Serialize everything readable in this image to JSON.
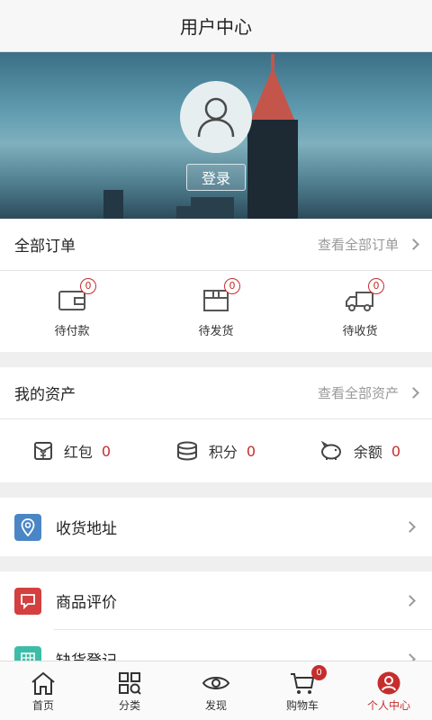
{
  "header": {
    "title": "用户中心"
  },
  "hero": {
    "login_label": "登录"
  },
  "orders": {
    "title": "全部订单",
    "more": "查看全部订单",
    "items": [
      {
        "label": "待付款",
        "count": "0",
        "icon": "wallet-icon"
      },
      {
        "label": "待发货",
        "count": "0",
        "icon": "package-icon"
      },
      {
        "label": "待收货",
        "count": "0",
        "icon": "truck-icon"
      }
    ]
  },
  "assets": {
    "title": "我的资产",
    "more": "查看全部资产",
    "items": [
      {
        "label": "红包",
        "value": "0",
        "icon": "red-envelope-icon"
      },
      {
        "label": "积分",
        "value": "0",
        "icon": "coins-icon"
      },
      {
        "label": "余额",
        "value": "0",
        "icon": "piggy-bank-icon"
      }
    ]
  },
  "menu": [
    {
      "label": "收货地址",
      "icon": "location-icon",
      "color": "#4a86c5"
    },
    {
      "label": "商品评价",
      "icon": "comment-icon",
      "color": "#d43f3f"
    },
    {
      "label": "缺货登记",
      "icon": "grid-icon",
      "color": "#3dbda7"
    }
  ],
  "tabbar": [
    {
      "label": "首页",
      "icon": "home-icon"
    },
    {
      "label": "分类",
      "icon": "category-icon"
    },
    {
      "label": "发现",
      "icon": "eye-icon"
    },
    {
      "label": "购物车",
      "icon": "cart-icon",
      "badge": "0"
    },
    {
      "label": "个人中心",
      "icon": "user-icon",
      "active": true
    }
  ],
  "colors": {
    "accent": "#c62d2d",
    "location": "#4a86c5",
    "comment": "#d43f3f",
    "grid": "#3dbda7"
  }
}
